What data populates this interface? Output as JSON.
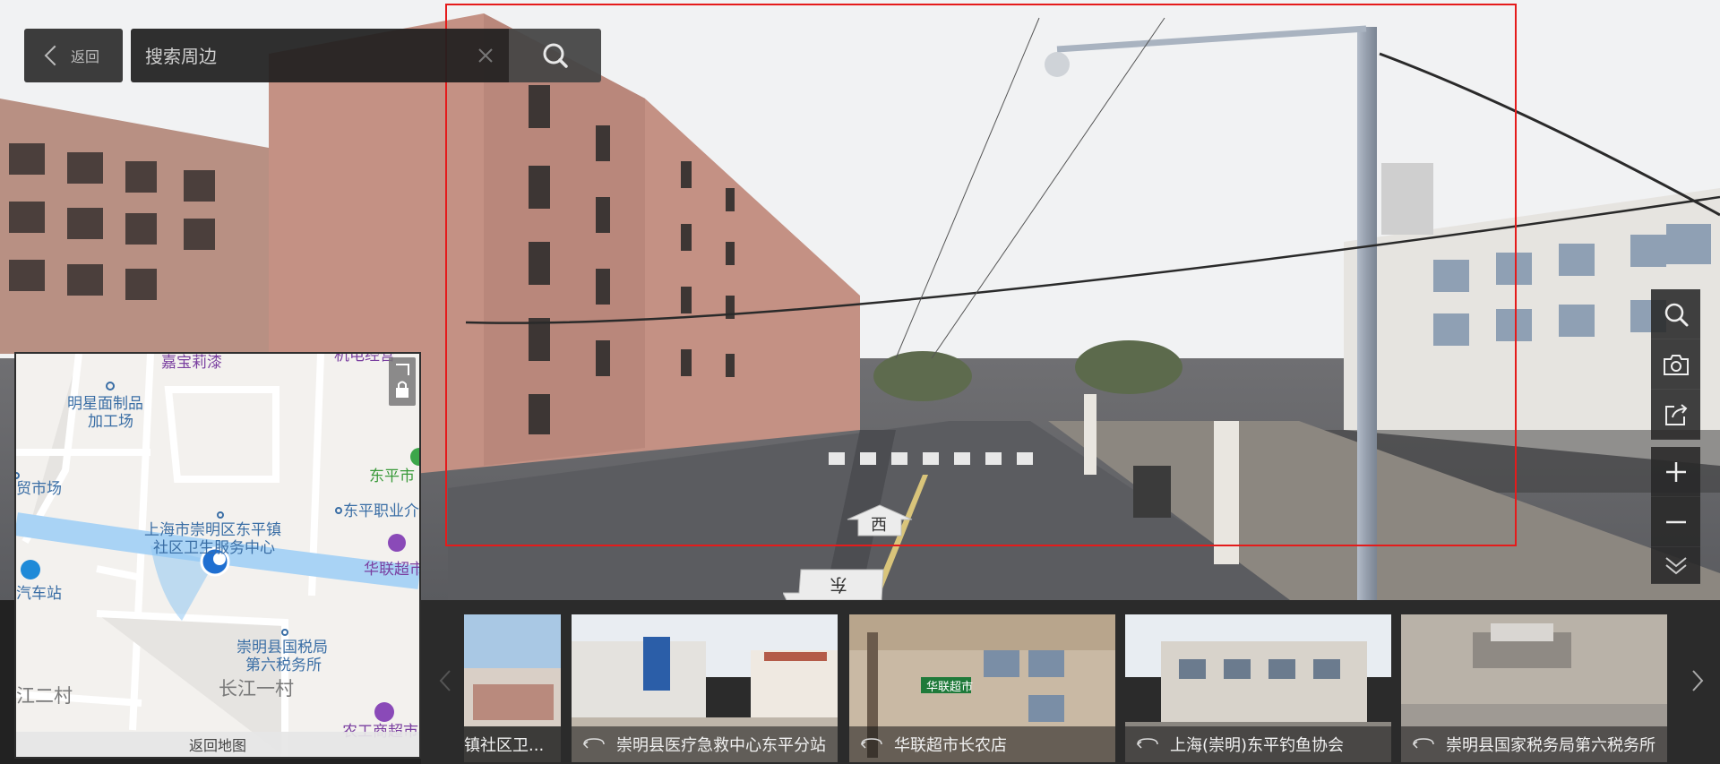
{
  "nav": {
    "back_label": "返回"
  },
  "search": {
    "placeholder": "搜索周边"
  },
  "road_arrows": {
    "west": "西",
    "east": "东"
  },
  "minimap": {
    "return_label": "返回地图",
    "labels": [
      "嘉宝莉漆",
      "机电经营",
      "明星面制品",
      "加工场",
      "贸市场",
      "东平市",
      "东平职业介",
      "上海市崇明区东平镇",
      "社区卫生服务中心",
      "华联超市",
      "汽车站",
      "崇明县国税局",
      "第六税务所",
      "长江一村",
      "江二村",
      "农工商超市"
    ]
  },
  "toolbar": {
    "icons": [
      "search-icon",
      "camera-icon",
      "share-icon",
      "zoom-in-icon",
      "zoom-out-icon",
      "collapse-icon"
    ]
  },
  "thumbnails": [
    {
      "caption": "镇社区卫..."
    },
    {
      "caption": "崇明县医疗急救中心东平分站"
    },
    {
      "caption": "华联超市长农店",
      "sign": "华联超市"
    },
    {
      "caption": "上海(崇明)东平钓鱼协会"
    },
    {
      "caption": "崇明县国家税务局第六税务所"
    }
  ],
  "colors": {
    "frame": "#e51b1b",
    "map_road": "#a9d3f5",
    "map_marker": "#1f6fd1",
    "toolbar_bg": "#282828"
  }
}
